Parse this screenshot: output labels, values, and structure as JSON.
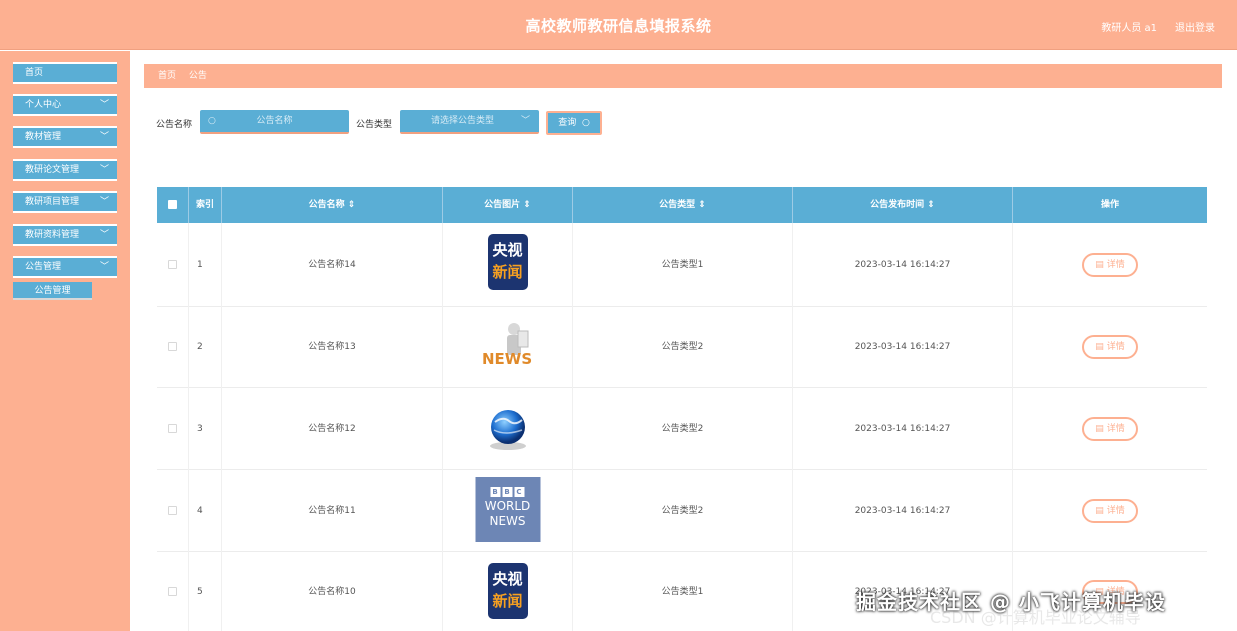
{
  "header": {
    "title": "高校教师教研信息填报系统",
    "user": "教研人员 a1",
    "logout": "退出登录"
  },
  "sidebar": {
    "items": [
      {
        "label": "首页",
        "has_chevron": false
      },
      {
        "label": "个人中心",
        "has_chevron": true
      },
      {
        "label": "教材管理",
        "has_chevron": true
      },
      {
        "label": "教研论文管理",
        "has_chevron": true
      },
      {
        "label": "教研项目管理",
        "has_chevron": true
      },
      {
        "label": "教研资料管理",
        "has_chevron": true
      },
      {
        "label": "公告管理",
        "has_chevron": true
      }
    ],
    "subitem": "公告管理"
  },
  "breadcrumb": {
    "home": "首页",
    "current": "公告"
  },
  "search": {
    "name_label": "公告名称",
    "name_placeholder": "公告名称",
    "type_label": "公告类型",
    "type_placeholder": "请选择公告类型",
    "button": "查询"
  },
  "table": {
    "columns": [
      "索引",
      "公告名称",
      "公告图片",
      "公告类型",
      "公告发布时间",
      "操作"
    ],
    "detail_label": "详情",
    "rows": [
      {
        "index": "1",
        "name": "公告名称14",
        "image": "cctv-news-logo",
        "type": "公告类型1",
        "time": "2023-03-14 16:14:27"
      },
      {
        "index": "2",
        "name": "公告名称13",
        "image": "news-figure-logo",
        "type": "公告类型2",
        "time": "2023-03-14 16:14:27"
      },
      {
        "index": "3",
        "name": "公告名称12",
        "image": "globe-logo",
        "type": "公告类型2",
        "time": "2023-03-14 16:14:27"
      },
      {
        "index": "4",
        "name": "公告名称11",
        "image": "bbc-world-news-logo",
        "type": "公告类型2",
        "time": "2023-03-14 16:14:27"
      },
      {
        "index": "5",
        "name": "公告名称10",
        "image": "cctv-news-logo",
        "type": "公告类型1",
        "time": "2023-03-14 16:14:27"
      }
    ]
  },
  "logos": {
    "cctv_top": "央视",
    "cctv_bottom": "新闻",
    "news": "NEWS",
    "bbc_letters": [
      "B",
      "B",
      "C"
    ],
    "bbc_world": "WORLD",
    "bbc_news": "NEWS"
  },
  "watermark": {
    "main": "掘金技术社区 @ 小飞计算机毕设",
    "sub": "CSDN @计算机毕业论文辅导"
  },
  "colors": {
    "accent_orange": "#fdb091",
    "accent_blue": "#5aaed5"
  }
}
